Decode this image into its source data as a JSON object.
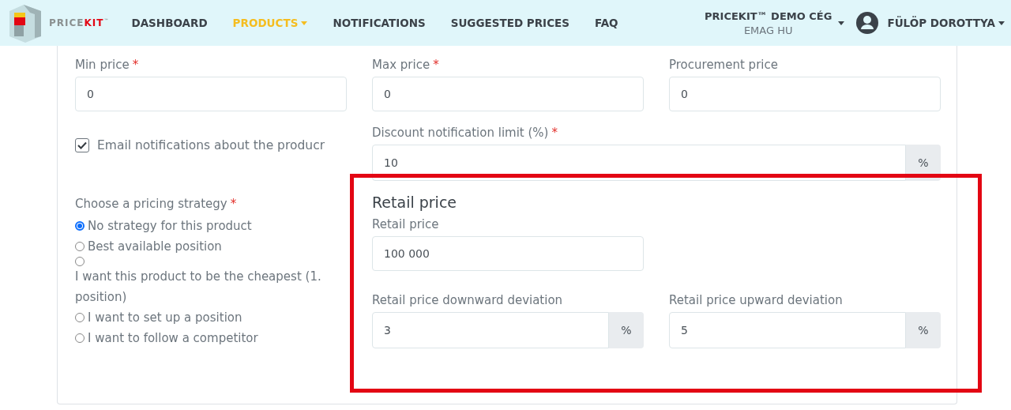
{
  "navbar": {
    "logo": {
      "part_1": "PRICE",
      "part_2": "KIT",
      "trademark": "™"
    },
    "links": [
      {
        "label": "DASHBOARD",
        "selected": false,
        "dropdown": false
      },
      {
        "label": "PRODUCTS",
        "selected": true,
        "dropdown": true
      },
      {
        "label": "NOTIFICATIONS",
        "selected": false,
        "dropdown": false
      },
      {
        "label": "SUGGESTED PRICES",
        "selected": false,
        "dropdown": false
      },
      {
        "label": "FAQ",
        "selected": false,
        "dropdown": false
      }
    ],
    "company": {
      "name": "PRICEKIT™ DEMO CÉG",
      "store": "EMAG HU"
    },
    "user": {
      "name": "FÜLÖP DOROTTYA"
    }
  },
  "form": {
    "price_fields": [
      {
        "label": "Min price",
        "required": "*",
        "value": "0"
      },
      {
        "label": "Max price",
        "required": "*",
        "value": "0"
      },
      {
        "label": "Procurement price",
        "value": "0"
      }
    ],
    "email_notifications": {
      "label": "Email notifications about the producr",
      "checked": true
    },
    "discount_limit": {
      "label": "Discount notification limit (%)",
      "required": "*",
      "value": "10",
      "unit": "%"
    },
    "strategy": {
      "label": "Choose a pricing strategy",
      "required": "*",
      "options": [
        {
          "label": "No strategy for this product",
          "selected": true,
          "wrapped": false
        },
        {
          "label": "Best available position",
          "selected": false,
          "wrapped": false
        },
        {
          "label": "I want this product to be the cheapest (1. position)",
          "selected": false,
          "wrapped": true
        },
        {
          "label": "I want to set up a position",
          "selected": false,
          "wrapped": false
        },
        {
          "label": "I want to follow a competitor",
          "selected": false,
          "wrapped": false
        }
      ]
    },
    "retail": {
      "heading": "Retail price",
      "price": {
        "label": "Retail price",
        "value": "100 000"
      },
      "downward": {
        "label": "Retail price downward deviation",
        "value": "3",
        "unit": "%"
      },
      "upward": {
        "label": "Retail price upward deviation",
        "value": "5",
        "unit": "%"
      },
      "highlighted": true
    }
  }
}
